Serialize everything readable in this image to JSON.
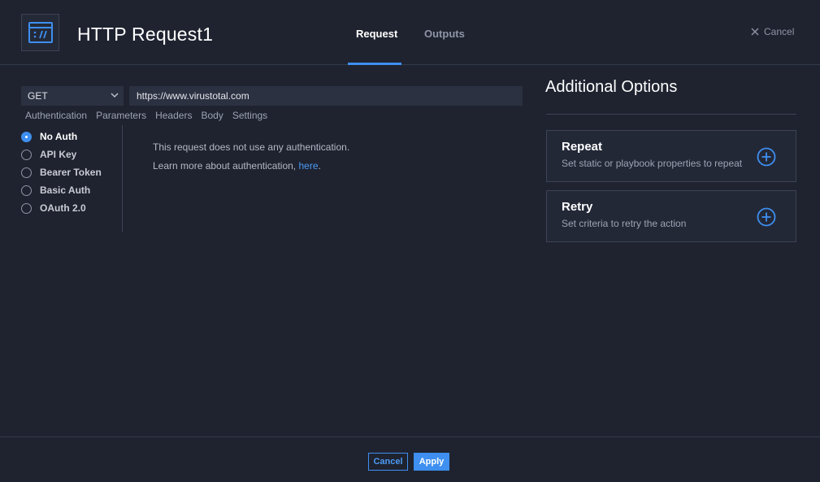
{
  "header": {
    "title": "HTTP Request1",
    "icon": "http-request-icon",
    "tabs": [
      {
        "label": "Request",
        "active": true
      },
      {
        "label": "Outputs",
        "active": false
      }
    ],
    "cancel_label": "Cancel"
  },
  "request": {
    "method": "GET",
    "url": "https://www.virustotal.com",
    "subtabs": [
      "Authentication",
      "Parameters",
      "Headers",
      "Body",
      "Settings"
    ],
    "auth_options": [
      {
        "label": "No Auth",
        "selected": true
      },
      {
        "label": "API Key",
        "selected": false
      },
      {
        "label": "Bearer Token",
        "selected": false
      },
      {
        "label": "Basic Auth",
        "selected": false
      },
      {
        "label": "OAuth 2.0",
        "selected": false
      }
    ],
    "auth_description": "This request does not use any authentication.",
    "learn_more_text": "Learn more about authentication, ",
    "learn_more_link": "here",
    "learn_more_suffix": "."
  },
  "additional_options": {
    "title": "Additional Options",
    "cards": [
      {
        "title": "Repeat",
        "subtitle": "Set static or playbook properties to repeat"
      },
      {
        "title": "Retry",
        "subtitle": "Set criteria to retry the action"
      }
    ]
  },
  "footer": {
    "cancel_label": "Cancel",
    "apply_label": "Apply"
  },
  "colors": {
    "background": "#1f2330",
    "accent": "#3e8ff0",
    "panel": "#2c3142"
  }
}
